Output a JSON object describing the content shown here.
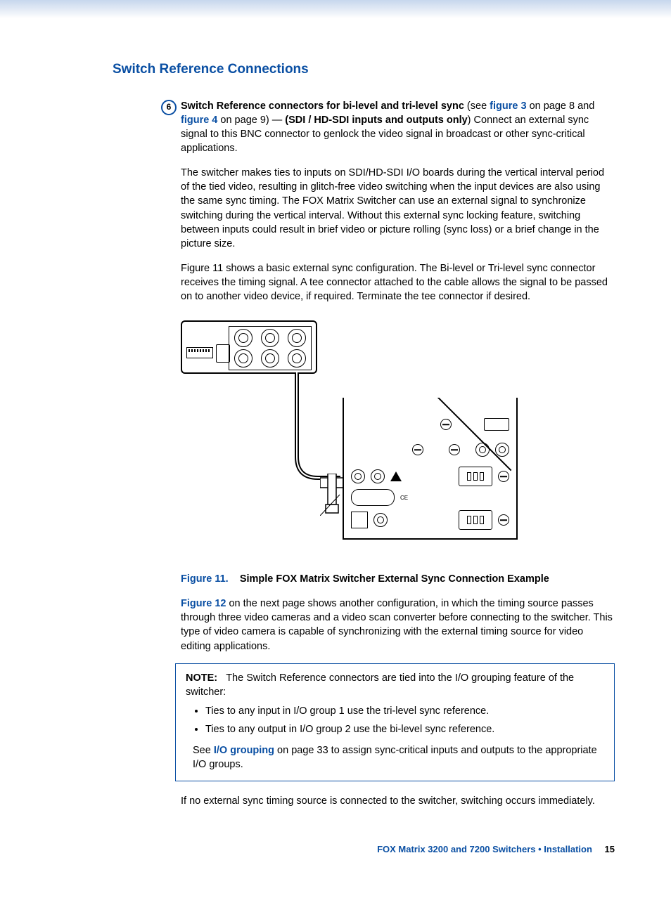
{
  "section_title": "Switch Reference Connections",
  "badge": "6",
  "p1": {
    "lead_bold": "Switch Reference connectors for bi-level and tri-level sync",
    "t1": " (see ",
    "link1": "figure 3",
    "t2": " on page 8 and ",
    "link2": "figure 4",
    "t3": " on page 9) — ",
    "bold2": "(SDI / HD-SDI inputs and outputs only",
    "t4": ") Connect an external sync signal to this BNC connector to genlock the video signal in broadcast or other sync-critical applications."
  },
  "p2": "The switcher makes ties to inputs on SDI/HD-SDI I/O boards during the vertical interval period of the tied video, resulting in glitch-free video switching when the input devices are also using the same sync timing. The FOX Matrix Switcher can use an external signal to synchronize switching during the vertical interval. Without this external sync locking feature, switching between inputs could result in brief video or picture rolling (sync loss) or a brief change in the picture size.",
  "p3": "Figure 11 shows a basic external sync configuration. The Bi-level or Tri-level sync connector receives the timing signal. A tee connector attached to the cable allows the signal to be passed on to another video device, if required. Terminate the tee connector if desired.",
  "figure": {
    "label": "Figure 11.",
    "title": "Simple FOX Matrix Switcher External Sync Connection Example"
  },
  "p4": {
    "link": "Figure 12",
    "rest": " on the next page shows another configuration, in which the timing source passes through three video cameras and a video scan converter before connecting to the switcher. This type of video camera is capable of synchronizing with the external timing source for video editing applications."
  },
  "note": {
    "label": "NOTE:",
    "intro": "The Switch Reference connectors are tied into the I/O grouping feature of the switcher:",
    "b1": "Ties to any input in I/O group 1 use the tri-level sync reference.",
    "b2": "Ties to any output in I/O group 2 use the bi-level sync reference.",
    "see_t1": "See ",
    "see_link": "I/O grouping",
    "see_t2": " on page 33 to assign sync-critical inputs and outputs to the appropriate I/O groups."
  },
  "p5": "If no external sync timing source is connected to the switcher, switching occurs immediately.",
  "footer": {
    "title": "FOX Matrix 3200 and 7200 Switchers • Installation",
    "page": "15"
  }
}
